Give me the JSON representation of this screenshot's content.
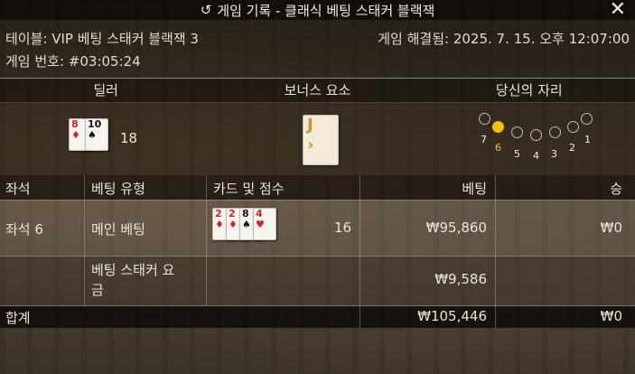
{
  "title": "게임 기록 - 클래식 베팅 스태커 블랙잭",
  "close_icon": "close-icon",
  "history_icon": "history-icon",
  "info": {
    "table": "테이블: VIP 베팅 스태커 블랙잭 3",
    "resolved": "게임 해결됨: 2025. 7. 15. 오후 12:07:00",
    "game_no": "게임 번호: #03:05:24"
  },
  "sections": {
    "dealer": "딜러",
    "bonus": "보너스 요소",
    "seat": "당신의 자리"
  },
  "dealer": {
    "cards": [
      {
        "rank": "8",
        "suit": "♦",
        "color": "red"
      },
      {
        "rank": "10",
        "suit": "♠",
        "color": "black"
      }
    ],
    "score": "18"
  },
  "bonus": {
    "card": {
      "rank": "J",
      "color": "gold"
    }
  },
  "seats": {
    "labels": [
      "7",
      "6",
      "5",
      "4",
      "3",
      "2",
      "1"
    ],
    "selected": "6"
  },
  "table_headers": {
    "seat": "좌석",
    "bet_type": "베팅 유형",
    "cards": "카드 및 점수",
    "bet": "베팅",
    "win": "승"
  },
  "rows": [
    {
      "seat": "좌석 6",
      "bet_type": "메인 베팅",
      "score": "16",
      "bet": "₩95,860",
      "win": "₩0",
      "cards": [
        {
          "rank": "2",
          "suit": "♦",
          "color": "red"
        },
        {
          "rank": "2",
          "suit": "♦",
          "color": "red"
        },
        {
          "rank": "8",
          "suit": "♠",
          "color": "black"
        },
        {
          "rank": "4",
          "suit": "♥",
          "color": "red"
        }
      ]
    },
    {
      "seat": "",
      "bet_type": "베팅 스태커 요\n금",
      "score": "",
      "bet": "₩9,586",
      "win": ""
    }
  ],
  "total": {
    "label": "합계",
    "bet": "₩105,446",
    "win": "₩0"
  }
}
